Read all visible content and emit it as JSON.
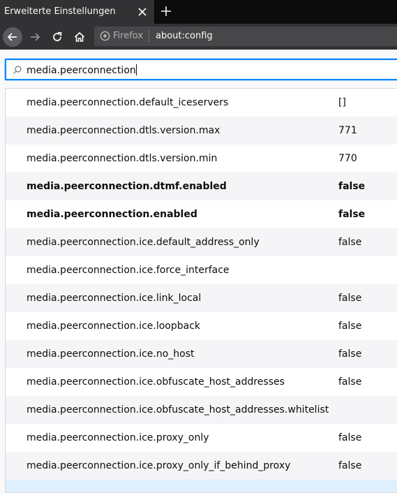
{
  "tab": {
    "title": "Erweiterte Einstellungen"
  },
  "urlbar": {
    "identity_label": "Firefox",
    "url": "about:config"
  },
  "search": {
    "value": "media.peerconnection"
  },
  "prefs": [
    {
      "name": "media.peerconnection.default_iceservers",
      "value": "[]",
      "modified": false
    },
    {
      "name": "media.peerconnection.dtls.version.max",
      "value": "771",
      "modified": false
    },
    {
      "name": "media.peerconnection.dtls.version.min",
      "value": "770",
      "modified": false
    },
    {
      "name": "media.peerconnection.dtmf.enabled",
      "value": "false",
      "modified": true
    },
    {
      "name": "media.peerconnection.enabled",
      "value": "false",
      "modified": true
    },
    {
      "name": "media.peerconnection.ice.default_address_only",
      "value": "false",
      "modified": false
    },
    {
      "name": "media.peerconnection.ice.force_interface",
      "value": "",
      "modified": false
    },
    {
      "name": "media.peerconnection.ice.link_local",
      "value": "false",
      "modified": false
    },
    {
      "name": "media.peerconnection.ice.loopback",
      "value": "false",
      "modified": false
    },
    {
      "name": "media.peerconnection.ice.no_host",
      "value": "false",
      "modified": false
    },
    {
      "name": "media.peerconnection.ice.obfuscate_host_addresses",
      "value": "false",
      "modified": false
    },
    {
      "name": "media.peerconnection.ice.obfuscate_host_addresses.whitelist",
      "value": "",
      "modified": false
    },
    {
      "name": "media.peerconnection.ice.proxy_only",
      "value": "false",
      "modified": false
    },
    {
      "name": "media.peerconnection.ice.proxy_only_if_behind_proxy",
      "value": "false",
      "modified": false
    },
    {
      "name": "",
      "value": "",
      "modified": false,
      "selected": true
    }
  ],
  "colors": {
    "accent": "#0a84ff",
    "toolbar": "#323234",
    "tabstrip": "#0c0c0d"
  }
}
